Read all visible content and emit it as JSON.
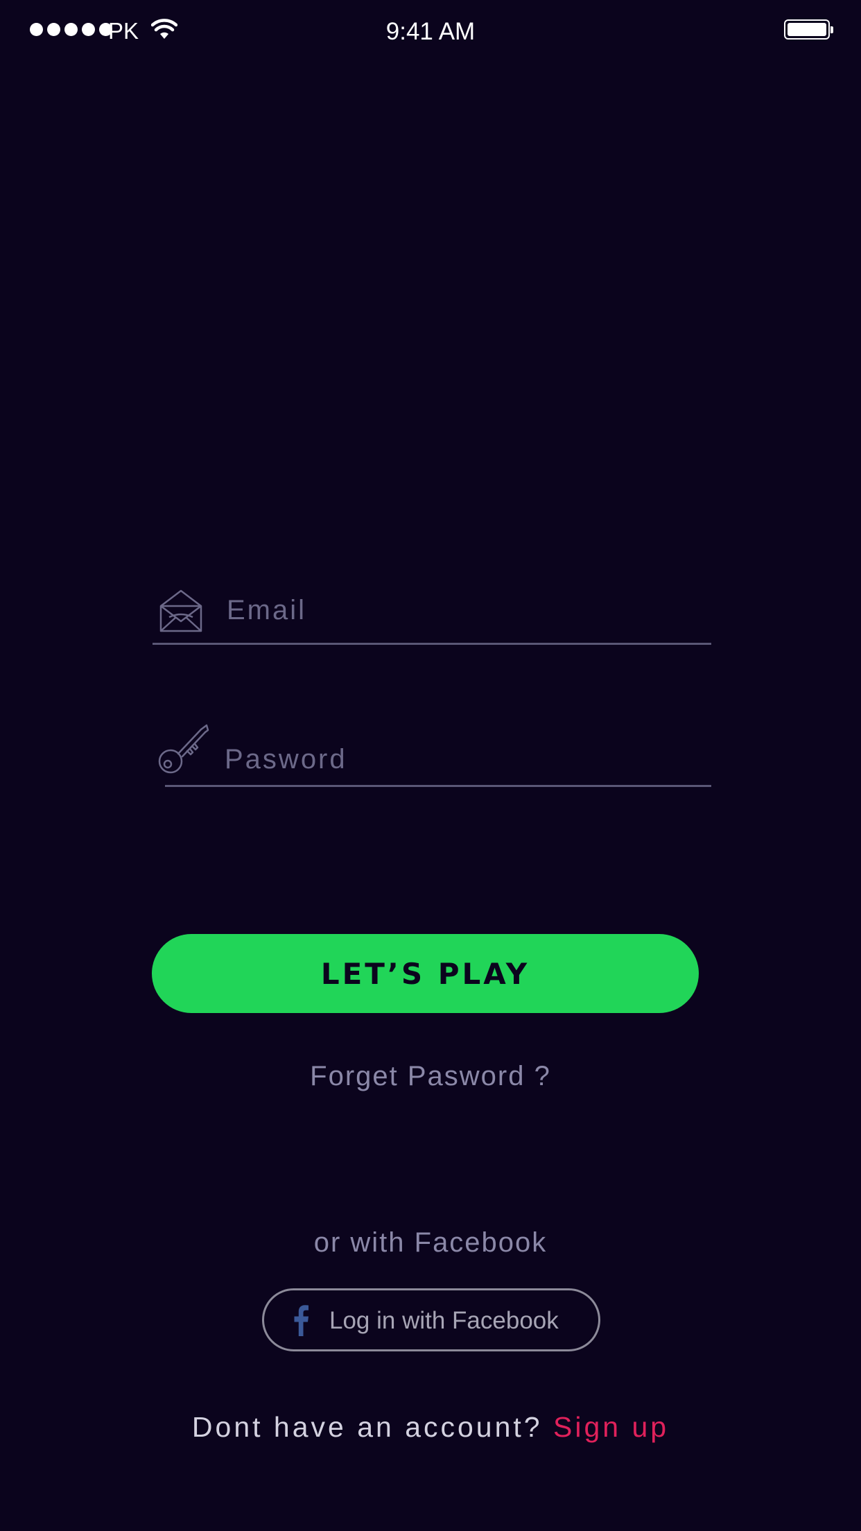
{
  "status_bar": {
    "carrier": "PK",
    "time": "9:41 AM",
    "signal_bars": 5,
    "battery_level": 1.0
  },
  "login_form": {
    "email": {
      "placeholder": "Email",
      "value": "",
      "icon": "envelope-icon"
    },
    "password": {
      "placeholder": "Pasword",
      "value": "",
      "icon": "key-icon"
    },
    "submit_label": "LET’S PLAY",
    "forgot_label": "Forget Pasword ?"
  },
  "social": {
    "prompt": "or with Facebook",
    "facebook_button_label": "Log in with Facebook",
    "facebook_icon": "facebook-icon"
  },
  "signup": {
    "prompt": "Dont have an account?",
    "link_label": "Sign up"
  },
  "colors": {
    "background": "#0b041d",
    "accent_green": "#21d558",
    "link_pink": "#e0215b",
    "muted_text": "#8b88a8",
    "facebook_blue": "#3b5998"
  }
}
